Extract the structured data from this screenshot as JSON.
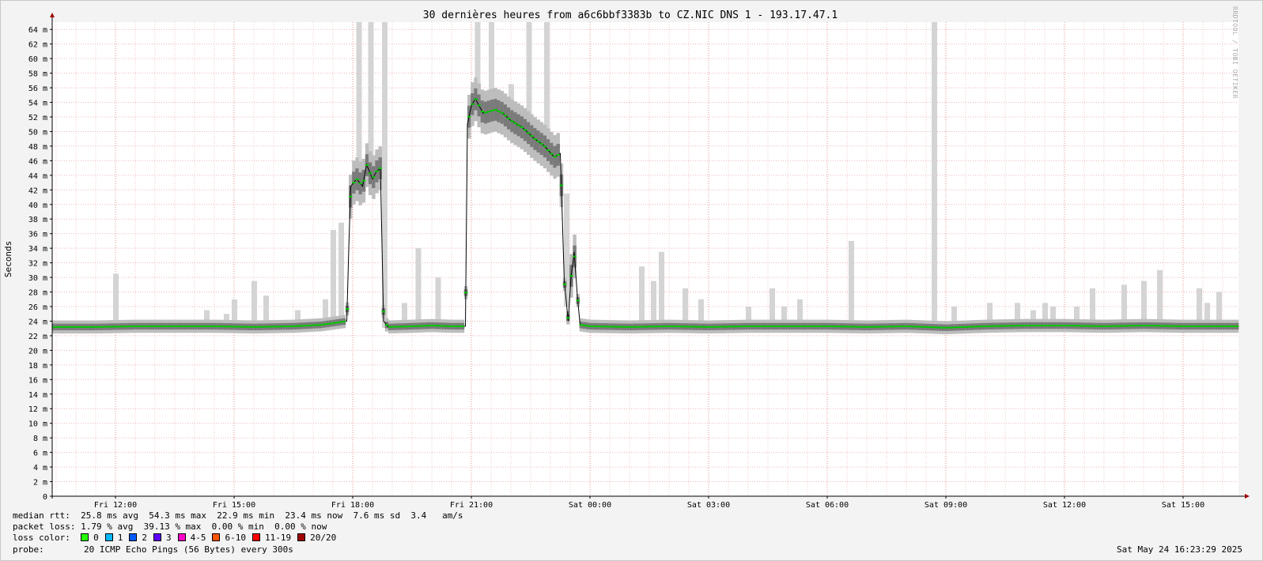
{
  "chart_data": {
    "type": "line",
    "title": "30 dernières heures from a6c6bbf3383b to CZ.NIC DNS 1 - 193.17.47.1",
    "ylabel": "Seconds",
    "xlabel": "",
    "ylim": [
      0,
      65
    ],
    "y_unit_label": "m",
    "y_ticks": [
      "0",
      "2 m",
      "4 m",
      "6 m",
      "8 m",
      "10 m",
      "12 m",
      "14 m",
      "16 m",
      "18 m",
      "20 m",
      "22 m",
      "24 m",
      "26 m",
      "28 m",
      "30 m",
      "32 m",
      "34 m",
      "36 m",
      "38 m",
      "40 m",
      "42 m",
      "44 m",
      "46 m",
      "48 m",
      "50 m",
      "52 m",
      "54 m",
      "56 m",
      "58 m",
      "60 m",
      "62 m",
      "64 m"
    ],
    "x_hours_range": [
      10.4,
      40.4
    ],
    "x_ticks": [
      {
        "label": "Fri 12:00",
        "hour": 12
      },
      {
        "label": "Fri 15:00",
        "hour": 15
      },
      {
        "label": "Fri 18:00",
        "hour": 18
      },
      {
        "label": "Fri 21:00",
        "hour": 21
      },
      {
        "label": "Sat 00:00",
        "hour": 24
      },
      {
        "label": "Sat 03:00",
        "hour": 27
      },
      {
        "label": "Sat 06:00",
        "hour": 30
      },
      {
        "label": "Sat 09:00",
        "hour": 33
      },
      {
        "label": "Sat 12:00",
        "hour": 36
      },
      {
        "label": "Sat 15:00",
        "hour": 39
      }
    ],
    "grid": true,
    "series": [
      {
        "name": "median rtt",
        "color": "#00c800",
        "points": [
          {
            "hour": 10.4,
            "ms": 23.2
          },
          {
            "hour": 11.5,
            "ms": 23.2
          },
          {
            "hour": 12.5,
            "ms": 23.3
          },
          {
            "hour": 13.5,
            "ms": 23.3
          },
          {
            "hour": 14.5,
            "ms": 23.3
          },
          {
            "hour": 15.5,
            "ms": 23.2
          },
          {
            "hour": 16.5,
            "ms": 23.3
          },
          {
            "hour": 17.2,
            "ms": 23.5
          },
          {
            "hour": 17.6,
            "ms": 23.8
          },
          {
            "hour": 17.85,
            "ms": 24.0
          },
          {
            "hour": 17.9,
            "ms": 34.0
          },
          {
            "hour": 17.95,
            "ms": 42.5
          },
          {
            "hour": 18.1,
            "ms": 43.5
          },
          {
            "hour": 18.25,
            "ms": 42.5
          },
          {
            "hour": 18.35,
            "ms": 45.5
          },
          {
            "hour": 18.5,
            "ms": 43.5
          },
          {
            "hour": 18.6,
            "ms": 44.5
          },
          {
            "hour": 18.7,
            "ms": 45.0
          },
          {
            "hour": 18.78,
            "ms": 24.0
          },
          {
            "hour": 18.9,
            "ms": 23.2
          },
          {
            "hour": 19.5,
            "ms": 23.3
          },
          {
            "hour": 20.0,
            "ms": 23.4
          },
          {
            "hour": 20.5,
            "ms": 23.3
          },
          {
            "hour": 20.85,
            "ms": 23.3
          },
          {
            "hour": 20.9,
            "ms": 51.0
          },
          {
            "hour": 21.0,
            "ms": 53.5
          },
          {
            "hour": 21.1,
            "ms": 54.5
          },
          {
            "hour": 21.3,
            "ms": 52.5
          },
          {
            "hour": 21.6,
            "ms": 53.0
          },
          {
            "hour": 21.8,
            "ms": 52.5
          },
          {
            "hour": 22.0,
            "ms": 51.5
          },
          {
            "hour": 22.3,
            "ms": 50.5
          },
          {
            "hour": 22.6,
            "ms": 49.0
          },
          {
            "hour": 22.85,
            "ms": 48.0
          },
          {
            "hour": 23.1,
            "ms": 46.5
          },
          {
            "hour": 23.25,
            "ms": 47.0
          },
          {
            "hour": 23.35,
            "ms": 29.5
          },
          {
            "hour": 23.45,
            "ms": 24.0
          },
          {
            "hour": 23.52,
            "ms": 30.0
          },
          {
            "hour": 23.6,
            "ms": 33.5
          },
          {
            "hour": 23.68,
            "ms": 27.5
          },
          {
            "hour": 23.75,
            "ms": 23.5
          },
          {
            "hour": 24.0,
            "ms": 23.3
          },
          {
            "hour": 25.0,
            "ms": 23.2
          },
          {
            "hour": 26.0,
            "ms": 23.3
          },
          {
            "hour": 27.0,
            "ms": 23.2
          },
          {
            "hour": 28.0,
            "ms": 23.3
          },
          {
            "hour": 29.0,
            "ms": 23.3
          },
          {
            "hour": 30.0,
            "ms": 23.3
          },
          {
            "hour": 31.0,
            "ms": 23.2
          },
          {
            "hour": 32.0,
            "ms": 23.3
          },
          {
            "hour": 33.0,
            "ms": 23.1
          },
          {
            "hour": 34.0,
            "ms": 23.3
          },
          {
            "hour": 35.0,
            "ms": 23.4
          },
          {
            "hour": 36.0,
            "ms": 23.4
          },
          {
            "hour": 37.0,
            "ms": 23.3
          },
          {
            "hour": 38.0,
            "ms": 23.4
          },
          {
            "hour": 39.0,
            "ms": 23.3
          },
          {
            "hour": 40.4,
            "ms": 23.3
          }
        ]
      }
    ],
    "smoke_spikes": [
      {
        "hour": 12.0,
        "max": 30.5
      },
      {
        "hour": 14.3,
        "max": 25.5
      },
      {
        "hour": 14.8,
        "max": 25.0
      },
      {
        "hour": 15.0,
        "max": 27.0
      },
      {
        "hour": 15.5,
        "max": 29.5
      },
      {
        "hour": 15.8,
        "max": 27.5
      },
      {
        "hour": 16.6,
        "max": 25.5
      },
      {
        "hour": 17.3,
        "max": 27.0
      },
      {
        "hour": 17.5,
        "max": 36.5
      },
      {
        "hour": 17.7,
        "max": 37.5
      },
      {
        "hour": 18.15,
        "max": 65.0
      },
      {
        "hour": 18.45,
        "max": 65.0
      },
      {
        "hour": 18.8,
        "max": 65.0
      },
      {
        "hour": 19.3,
        "max": 26.5
      },
      {
        "hour": 19.65,
        "max": 34.0
      },
      {
        "hour": 20.15,
        "max": 30.0
      },
      {
        "hour": 21.15,
        "max": 65.0
      },
      {
        "hour": 21.5,
        "max": 65.0
      },
      {
        "hour": 22.0,
        "max": 56.5
      },
      {
        "hour": 22.45,
        "max": 65.0
      },
      {
        "hour": 22.9,
        "max": 65.0
      },
      {
        "hour": 23.4,
        "max": 41.5
      },
      {
        "hour": 25.3,
        "max": 31.5
      },
      {
        "hour": 25.6,
        "max": 29.5
      },
      {
        "hour": 25.8,
        "max": 33.5
      },
      {
        "hour": 26.4,
        "max": 28.5
      },
      {
        "hour": 26.8,
        "max": 27.0
      },
      {
        "hour": 28.0,
        "max": 26.0
      },
      {
        "hour": 28.6,
        "max": 28.5
      },
      {
        "hour": 28.9,
        "max": 26.0
      },
      {
        "hour": 29.3,
        "max": 27.0
      },
      {
        "hour": 30.6,
        "max": 35.0
      },
      {
        "hour": 32.7,
        "max": 65.0
      },
      {
        "hour": 33.2,
        "max": 26.0
      },
      {
        "hour": 34.1,
        "max": 26.5
      },
      {
        "hour": 34.8,
        "max": 26.5
      },
      {
        "hour": 35.2,
        "max": 25.5
      },
      {
        "hour": 35.5,
        "max": 26.5
      },
      {
        "hour": 35.7,
        "max": 26.0
      },
      {
        "hour": 36.3,
        "max": 26.0
      },
      {
        "hour": 36.7,
        "max": 28.5
      },
      {
        "hour": 37.5,
        "max": 29.0
      },
      {
        "hour": 38.0,
        "max": 29.5
      },
      {
        "hour": 38.4,
        "max": 31.0
      },
      {
        "hour": 39.4,
        "max": 28.5
      },
      {
        "hour": 39.6,
        "max": 26.5
      },
      {
        "hour": 39.9,
        "max": 28.0
      }
    ]
  },
  "watermark": "RRDTOOL / TOBI OETIKER",
  "legend": {
    "median_rtt": {
      "label": "median rtt:",
      "text": "25.8 ms avg  54.3 ms max  22.9 ms min  23.4 ms now  7.6 ms sd  3.4   am/s"
    },
    "packet_loss": {
      "label": "packet loss:",
      "text": "1.79 % avg  39.13 % max  0.00 % min  0.00 % now"
    },
    "loss_color": {
      "label": "loss color:",
      "items": [
        {
          "label": "0",
          "color": "#26ff00"
        },
        {
          "label": "1",
          "color": "#00b8ff"
        },
        {
          "label": "2",
          "color": "#0059ff"
        },
        {
          "label": "3",
          "color": "#5e00ff"
        },
        {
          "label": "4-5",
          "color": "#ff00c8"
        },
        {
          "label": "6-10",
          "color": "#ff5500"
        },
        {
          "label": "11-19",
          "color": "#ff0000"
        },
        {
          "label": "20/20",
          "color": "#a10000"
        }
      ]
    },
    "probe": {
      "label": "probe:",
      "text": "20 ICMP Echo Pings (56 Bytes) every 300s"
    }
  },
  "timestamp": "Sat May 24 16:23:29 2025"
}
